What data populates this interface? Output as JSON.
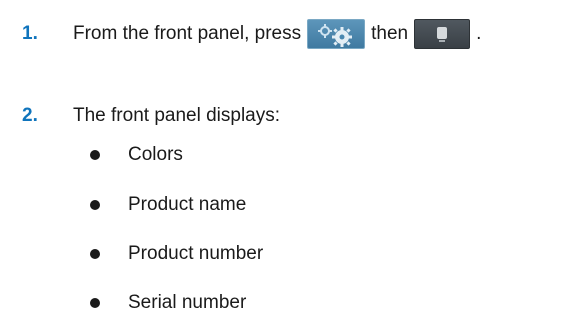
{
  "steps": [
    {
      "number": "1.",
      "text_before": "From the front panel, press",
      "text_between": "then",
      "text_after": ".",
      "buttons": [
        {
          "icon": "settings-gears-icon",
          "color": "#4a88b0"
        },
        {
          "icon": "information-icon",
          "color": "#454c52"
        }
      ]
    },
    {
      "number": "2.",
      "text": "The front panel displays:"
    }
  ],
  "bullets": [
    "Colors",
    "Product name",
    "Product number",
    "Serial number"
  ]
}
